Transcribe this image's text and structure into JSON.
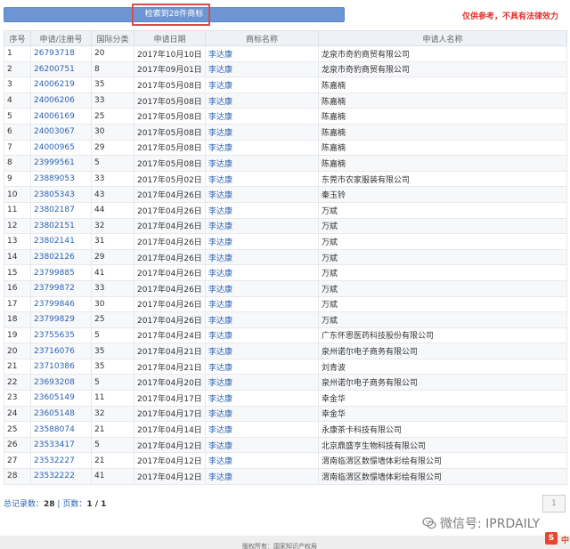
{
  "header": {
    "search_button_label": "检索到28件商标",
    "disclaimer": "仅供参考，不具有法律效力"
  },
  "table": {
    "columns": [
      "序号",
      "申请/注册号",
      "国际分类",
      "申请日期",
      "商标名称",
      "申请人名称"
    ],
    "rows": [
      [
        "1",
        "26793718",
        "20",
        "2017年10月10日",
        "李达康",
        "龙泉市奇豹商贸有限公司"
      ],
      [
        "2",
        "26200751",
        "8",
        "2017年09月01日",
        "李达康",
        "龙泉市奇豹商贸有限公司"
      ],
      [
        "3",
        "24006219",
        "35",
        "2017年05月08日",
        "李达康",
        "陈嘉楠"
      ],
      [
        "4",
        "24006206",
        "33",
        "2017年05月08日",
        "李达康",
        "陈嘉楠"
      ],
      [
        "5",
        "24006169",
        "25",
        "2017年05月08日",
        "李达康",
        "陈嘉楠"
      ],
      [
        "6",
        "24003067",
        "30",
        "2017年05月08日",
        "李达康",
        "陈嘉楠"
      ],
      [
        "7",
        "24000965",
        "29",
        "2017年05月08日",
        "李达康",
        "陈嘉楠"
      ],
      [
        "8",
        "23999561",
        "5",
        "2017年05月08日",
        "李达康",
        "陈嘉楠"
      ],
      [
        "9",
        "23889053",
        "33",
        "2017年05月02日",
        "李达康",
        "东莞市农家服装有限公司"
      ],
      [
        "10",
        "23805343",
        "43",
        "2017年04月26日",
        "李达康",
        "秦玉铃"
      ],
      [
        "11",
        "23802187",
        "44",
        "2017年04月26日",
        "李达康",
        "万斌"
      ],
      [
        "12",
        "23802151",
        "32",
        "2017年04月26日",
        "李达康",
        "万斌"
      ],
      [
        "13",
        "23802141",
        "31",
        "2017年04月26日",
        "李达康",
        "万斌"
      ],
      [
        "14",
        "23802126",
        "29",
        "2017年04月26日",
        "李达康",
        "万斌"
      ],
      [
        "15",
        "23799885",
        "41",
        "2017年04月26日",
        "李达康",
        "万斌"
      ],
      [
        "16",
        "23799872",
        "33",
        "2017年04月26日",
        "李达康",
        "万斌"
      ],
      [
        "17",
        "23799846",
        "30",
        "2017年04月26日",
        "李达康",
        "万斌"
      ],
      [
        "18",
        "23799829",
        "25",
        "2017年04月26日",
        "李达康",
        "万斌"
      ],
      [
        "19",
        "23755635",
        "5",
        "2017年04月24日",
        "李达康",
        "广东怀恩医药科技股份有限公司"
      ],
      [
        "20",
        "23716076",
        "35",
        "2017年04月21日",
        "李达康",
        "泉州诺尔电子商务有限公司"
      ],
      [
        "21",
        "23710386",
        "35",
        "2017年04月21日",
        "李达康",
        "刘青波"
      ],
      [
        "22",
        "23693208",
        "5",
        "2017年04月20日",
        "李达康",
        "泉州诺尔电子商务有限公司"
      ],
      [
        "23",
        "23605149",
        "11",
        "2017年04月17日",
        "李达康",
        "幸金华"
      ],
      [
        "24",
        "23605148",
        "32",
        "2017年04月17日",
        "李达康",
        "幸金华"
      ],
      [
        "25",
        "23588074",
        "21",
        "2017年04月14日",
        "李达康",
        "永康茶卡科技有限公司"
      ],
      [
        "26",
        "23533417",
        "5",
        "2017年04月12日",
        "李达康",
        "北京鼎盛亨生物科技有限公司"
      ],
      [
        "27",
        "23532227",
        "21",
        "2017年04月12日",
        "李达康",
        "渭南临渭区数憬墙体彩绘有限公司"
      ],
      [
        "28",
        "23532222",
        "41",
        "2017年04月12日",
        "李达康",
        "渭南临渭区数憬墙体彩绘有限公司"
      ]
    ]
  },
  "summary": {
    "total_label": "总记录数：",
    "total_value": "28",
    "separator": " | ",
    "pages_label": "页数：",
    "pages_value": "1 / 1"
  },
  "pager": {
    "page_input": "1"
  },
  "watermark": {
    "text": "微信号: IPRDAILY",
    "icon": "wechat-icon"
  },
  "footer": {
    "text": "版权所有：国家知识产权局",
    "logo_letter": "S",
    "logo_text": "中"
  },
  "colors": {
    "accent": "#6d95d3",
    "link": "#2b63b5",
    "disclaimer": "#e0302a",
    "highlight": "#d94a4a"
  }
}
